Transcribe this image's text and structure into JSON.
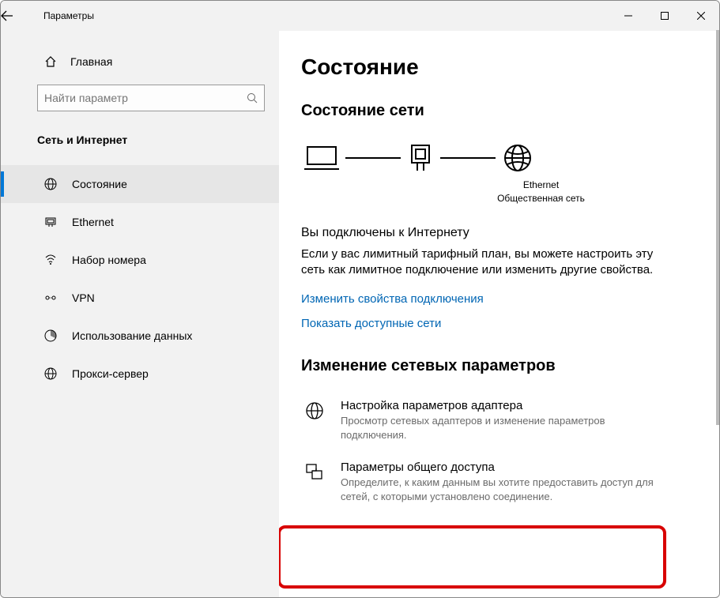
{
  "window": {
    "title": "Параметры"
  },
  "sidebar": {
    "home_label": "Главная",
    "search_placeholder": "Найти параметр",
    "category": "Сеть и Интернет",
    "items": [
      {
        "label": "Состояние"
      },
      {
        "label": "Ethernet"
      },
      {
        "label": "Набор номера"
      },
      {
        "label": "VPN"
      },
      {
        "label": "Использование данных"
      },
      {
        "label": "Прокси-сервер"
      }
    ]
  },
  "main": {
    "page_title": "Состояние",
    "status_heading": "Состояние сети",
    "diagram": {
      "conn_label": "Ethernet",
      "conn_sub": "Общественная сеть"
    },
    "connected_heading": "Вы подключены к Интернету",
    "connected_body": "Если у вас лимитный тарифный план, вы можете настроить эту сеть как лимитное подключение или изменить другие свойства.",
    "link_change_props": "Изменить свойства подключения",
    "link_show_nets": "Показать доступные сети",
    "change_heading": "Изменение сетевых параметров",
    "adapter": {
      "title": "Настройка параметров адаптера",
      "desc": "Просмотр сетевых адаптеров и изменение параметров подключения."
    },
    "sharing": {
      "title": "Параметры общего доступа",
      "desc": "Определите, к каким данным вы хотите предоставить доступ для сетей, с которыми установлено соединение."
    }
  }
}
